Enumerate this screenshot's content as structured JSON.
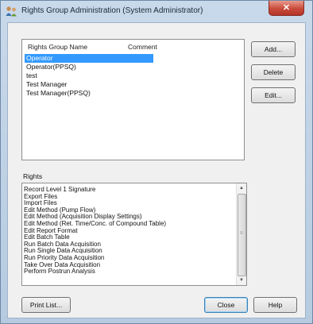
{
  "window": {
    "title": "Rights Group Administration (System Administrator)"
  },
  "groups": {
    "headers": {
      "name": "Rights Group Name",
      "comment": "Comment"
    },
    "rows": [
      "Operator",
      "Operator(PPSQ)",
      "test",
      "Test Manager",
      "Test Manager(PPSQ)"
    ],
    "selected_index": 0
  },
  "buttons": {
    "add": "Add...",
    "delete": "Delete",
    "edit": "Edit...",
    "print_list": "Print List...",
    "close": "Close",
    "help": "Help"
  },
  "rights": {
    "label": "Rights",
    "items": [
      "Record Level 1 Signature",
      "Export Files",
      "Import Files",
      "Edit Method (Pump Flow)",
      "Edit Method (Acquisition Display Settings)",
      "Edit Method (Ret. Time/Conc. of Compound Table)",
      "Edit Report Format",
      "Edit Batch Table",
      "Run Batch Data Acquisition",
      "Run Single Data Acquisition",
      "Run Priority Data Acquisition",
      "Take Over Data Acquisition",
      "Perform Postrun Analysis"
    ]
  },
  "icons": {
    "app": "rights-group-app-icon",
    "close": "close-icon",
    "scroll_up": "scroll-up-icon",
    "scroll_down": "scroll-down-icon"
  },
  "colors": {
    "selection": "#3399ff",
    "close_button": "#c94a3a"
  }
}
